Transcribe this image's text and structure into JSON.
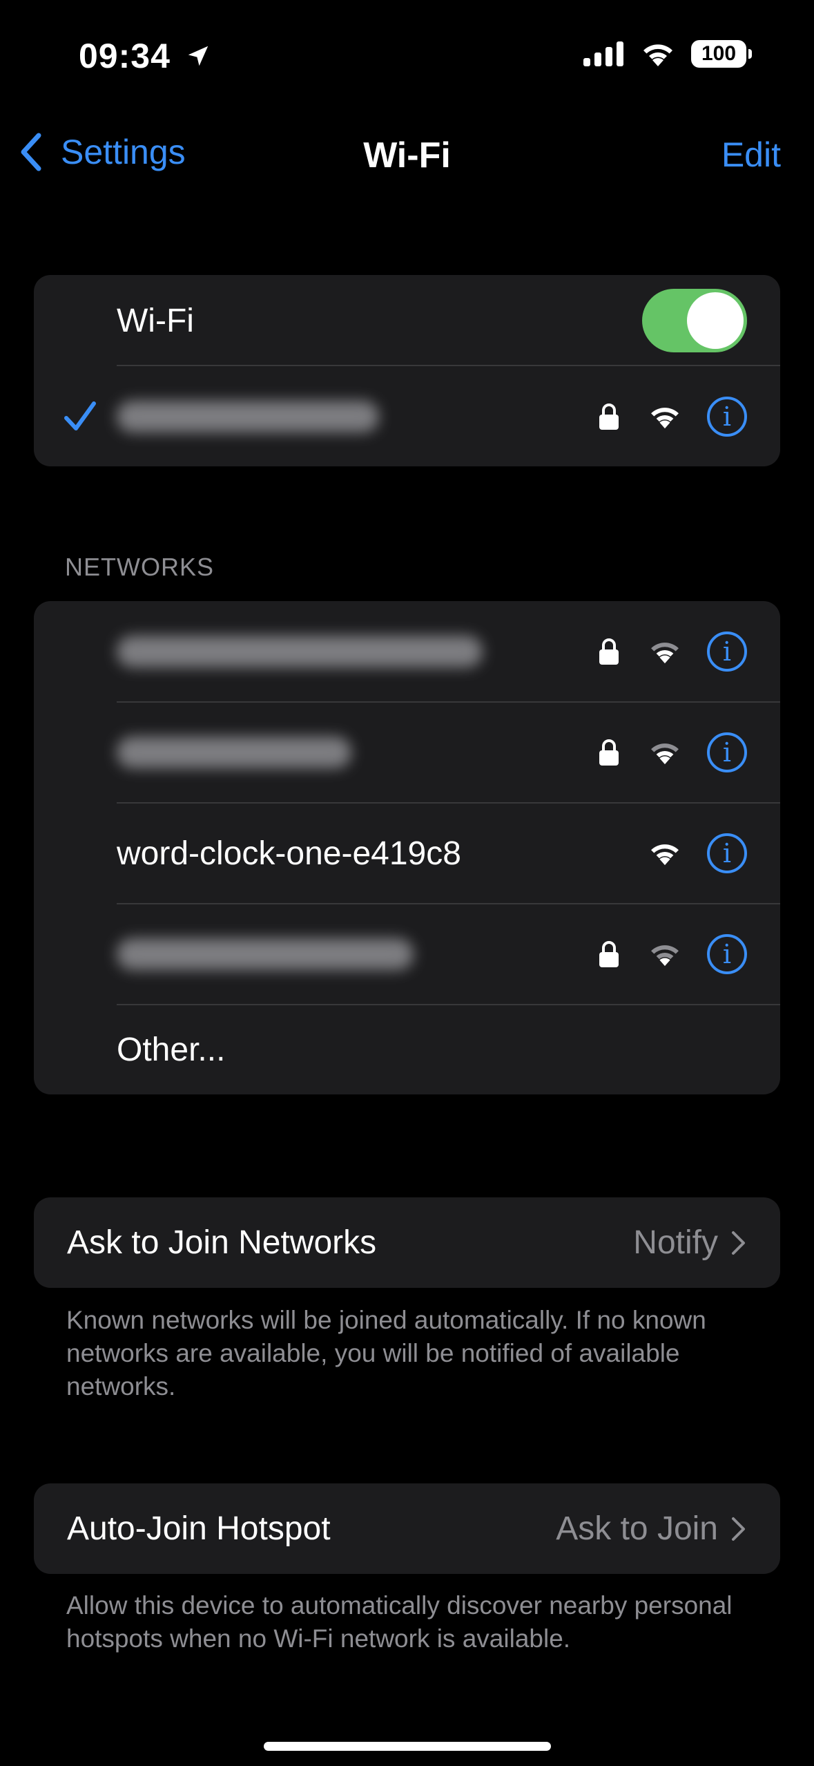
{
  "status_bar": {
    "time": "09:34",
    "battery": "100"
  },
  "nav": {
    "back_label": "Settings",
    "title": "Wi-Fi",
    "edit_label": "Edit"
  },
  "wifi": {
    "label": "Wi-Fi",
    "enabled": true,
    "connected_network": {
      "secured": true
    }
  },
  "networks": {
    "header": "NETWORKS",
    "items": [
      {
        "name": "",
        "blurred": true,
        "secured": true
      },
      {
        "name": "",
        "blurred": true,
        "secured": true
      },
      {
        "name": "word-clock-one-e419c8",
        "blurred": false,
        "secured": false
      },
      {
        "name": "",
        "blurred": true,
        "secured": true
      }
    ],
    "other_label": "Other..."
  },
  "ask_to_join": {
    "label": "Ask to Join Networks",
    "value": "Notify",
    "footer": "Known networks will be joined automatically. If no known networks are available, you will be notified of available networks."
  },
  "auto_join_hotspot": {
    "label": "Auto-Join Hotspot",
    "value": "Ask to Join",
    "footer": "Allow this device to automatically discover nearby personal hotspots when no Wi-Fi network is available."
  },
  "colors": {
    "accent": "#3a8ef6",
    "toggle_on": "#65c466",
    "cell_bg": "#1c1c1e",
    "secondary_text": "#8e8e93"
  },
  "icons": [
    "location-arrow-icon",
    "cellular-signal-icon",
    "wifi-status-icon",
    "battery-icon",
    "chevron-left-icon",
    "checkmark-icon",
    "lock-icon",
    "wifi-signal-icon",
    "info-icon",
    "chevron-right-icon"
  ]
}
